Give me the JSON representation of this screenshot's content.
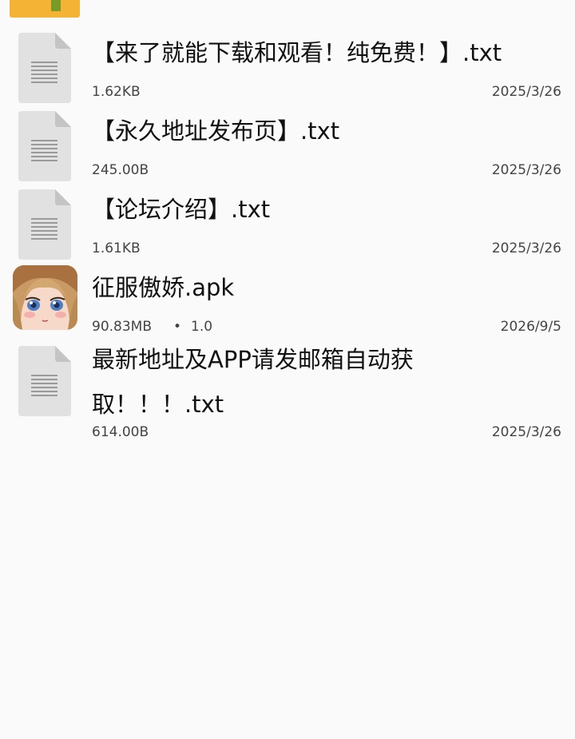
{
  "colors": {
    "background": "#fafafa",
    "folder": "#f5b335",
    "doc_icon": "#e1e1e1",
    "doc_fold": "#c4c4c4",
    "doc_lines": "#9a9a9a"
  },
  "files": [
    {
      "name": "【来了就能下载和观看！纯免费！】.txt",
      "size": "1.62KB",
      "date": "2025/3/26",
      "icon": "text-document-icon"
    },
    {
      "name": "【永久地址发布页】.txt",
      "size": "245.00B",
      "date": "2025/3/26",
      "icon": "text-document-icon"
    },
    {
      "name": "【论坛介绍】.txt",
      "size": "1.61KB",
      "date": "2025/3/26",
      "icon": "text-document-icon"
    },
    {
      "name": "征服傲娇.apk",
      "size": "90.83MB",
      "separator": "•",
      "version": "1.0",
      "date": "2026/9/5",
      "icon": "anime-girl-app-icon"
    },
    {
      "name": "最新地址及APP请发邮箱自动获取！！！.txt",
      "size": "614.00B",
      "date": "2025/3/26",
      "icon": "text-document-icon"
    }
  ]
}
